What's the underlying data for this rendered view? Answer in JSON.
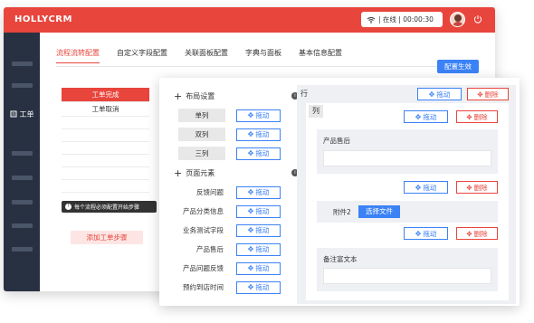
{
  "app": {
    "brand": "HOLLYCRM",
    "status": "| 在线 | 00:00:30",
    "power_icon": "power-icon",
    "wifi_icon": "wifi-icon",
    "accent": "#e8453c"
  },
  "sidebar": {
    "item_label": "工单",
    "item_icon": "ticket-icon"
  },
  "tabs": [
    "流程流转配置",
    "自定义字段配置",
    "关联面板配置",
    "字典与面板",
    "基本信息配置"
  ],
  "apply_button": "配置生效",
  "steps": {
    "header": "工单完成",
    "items": [
      "工单取消"
    ]
  },
  "hint": "每个流程必须配置开始步骤",
  "add_step": "添加工单步骤",
  "layout": {
    "title": "布局设置",
    "items": [
      "单列",
      "双列",
      "三列"
    ],
    "drag_label": "拖动"
  },
  "elements": {
    "title": "页面元素",
    "items": [
      "反馈问题",
      "产品分类信息",
      "业务测试字段",
      "产品售后",
      "产品问题反馈",
      "预约到店时间"
    ]
  },
  "canvas": {
    "row_label": "行",
    "col_label": "列",
    "drag_label": "拖动",
    "delete_label": "删除",
    "field1": "产品售后",
    "field2": "附件2",
    "file_button": "选择文件",
    "field3": "备注富文本"
  }
}
